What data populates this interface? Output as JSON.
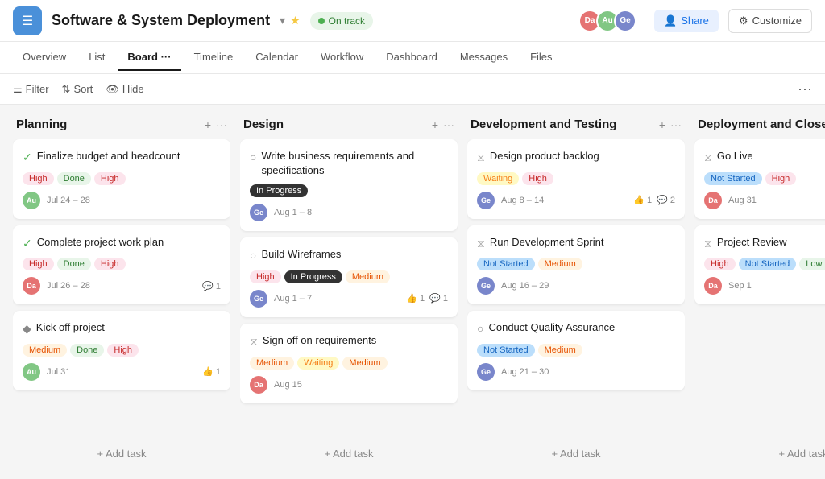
{
  "header": {
    "menu_label": "☰",
    "project_title": "Software & System Deployment",
    "chevron": "▾",
    "star": "★",
    "status": "On track",
    "share_label": "Share",
    "customize_label": "Customize",
    "avatars": [
      {
        "initials": "Da",
        "class": "av-da"
      },
      {
        "initials": "Au",
        "class": "av-au"
      },
      {
        "initials": "Ge",
        "class": "av-ge"
      }
    ]
  },
  "nav_tabs": [
    {
      "label": "Overview",
      "active": false
    },
    {
      "label": "List",
      "active": false
    },
    {
      "label": "Board",
      "active": true
    },
    {
      "label": "Timeline",
      "active": false
    },
    {
      "label": "Calendar",
      "active": false
    },
    {
      "label": "Workflow",
      "active": false
    },
    {
      "label": "Dashboard",
      "active": false
    },
    {
      "label": "Messages",
      "active": false
    },
    {
      "label": "Files",
      "active": false
    }
  ],
  "toolbar": {
    "filter_label": "Filter",
    "sort_label": "Sort",
    "hide_label": "Hide"
  },
  "board": {
    "columns": [
      {
        "id": "planning",
        "title": "Planning",
        "cards": [
          {
            "id": "c1",
            "icon_type": "check",
            "icon": "✓",
            "title": "Finalize budget and headcount",
            "tags": [
              {
                "label": "High",
                "class": "tag-high"
              },
              {
                "label": "Done",
                "class": "tag-done"
              },
              {
                "label": "High",
                "class": "tag-high"
              }
            ],
            "avatar_initials": "Au",
            "avatar_class": "av-au",
            "date": "Jul 24 – 28",
            "meta": []
          },
          {
            "id": "c2",
            "icon_type": "check",
            "icon": "✓",
            "title": "Complete project work plan",
            "tags": [
              {
                "label": "High",
                "class": "tag-high"
              },
              {
                "label": "Done",
                "class": "tag-done"
              },
              {
                "label": "High",
                "class": "tag-high"
              }
            ],
            "avatar_initials": "Da",
            "avatar_class": "av-da",
            "date": "Jul 26 – 28",
            "meta": [
              {
                "icon": "💬",
                "count": "1"
              }
            ]
          },
          {
            "id": "c3",
            "icon_type": "diamond",
            "icon": "◆",
            "title": "Kick off project",
            "tags": [
              {
                "label": "Medium",
                "class": "tag-medium"
              },
              {
                "label": "Done",
                "class": "tag-done"
              },
              {
                "label": "High",
                "class": "tag-high"
              }
            ],
            "avatar_initials": "Au",
            "avatar_class": "av-au",
            "date": "Jul 31",
            "meta": [
              {
                "icon": "👍",
                "count": "1"
              }
            ]
          }
        ],
        "add_task": "+ Add task"
      },
      {
        "id": "design",
        "title": "Design",
        "cards": [
          {
            "id": "c4",
            "icon_type": "circle",
            "icon": "○",
            "title": "Write business requirements and specifications",
            "tags": [
              {
                "label": "In Progress",
                "class": "tag-in-progress"
              }
            ],
            "avatar_initials": "Ge",
            "avatar_class": "av-ge",
            "date": "Aug 1 – 8",
            "meta": []
          },
          {
            "id": "c5",
            "icon_type": "circle",
            "icon": "○",
            "title": "Build Wireframes",
            "tags": [
              {
                "label": "High",
                "class": "tag-high"
              },
              {
                "label": "In Progress",
                "class": "tag-in-progress"
              },
              {
                "label": "Medium",
                "class": "tag-medium"
              }
            ],
            "avatar_initials": "Ge",
            "avatar_class": "av-ge",
            "date": "Aug 1 – 7",
            "meta": [
              {
                "icon": "👍",
                "count": "1"
              },
              {
                "icon": "💬",
                "count": "1"
              }
            ]
          },
          {
            "id": "c6",
            "icon_type": "hourglass",
            "icon": "⧖",
            "title": "Sign off on requirements",
            "tags": [
              {
                "label": "Medium",
                "class": "tag-medium"
              },
              {
                "label": "Waiting",
                "class": "tag-waiting"
              },
              {
                "label": "Medium",
                "class": "tag-medium"
              }
            ],
            "avatar_initials": "Da",
            "avatar_class": "av-da",
            "date": "Aug 15",
            "meta": []
          }
        ],
        "add_task": "+ Add task"
      },
      {
        "id": "dev-testing",
        "title": "Development and Testing",
        "cards": [
          {
            "id": "c7",
            "icon_type": "hourglass",
            "icon": "⧖",
            "title": "Design product backlog",
            "tags": [
              {
                "label": "Waiting",
                "class": "tag-waiting"
              },
              {
                "label": "High",
                "class": "tag-high"
              }
            ],
            "avatar_initials": "Ge",
            "avatar_class": "av-ge",
            "date": "Aug 8 – 14",
            "meta": [
              {
                "icon": "👍",
                "count": "1"
              },
              {
                "icon": "💬",
                "count": "2"
              }
            ]
          },
          {
            "id": "c8",
            "icon_type": "hourglass",
            "icon": "⧖",
            "title": "Run Development Sprint",
            "tags": [
              {
                "label": "Not Started",
                "class": "tag-not-started"
              },
              {
                "label": "Medium",
                "class": "tag-medium"
              }
            ],
            "avatar_initials": "Ge",
            "avatar_class": "av-ge",
            "date": "Aug 16 – 29",
            "meta": []
          },
          {
            "id": "c9",
            "icon_type": "circle",
            "icon": "○",
            "title": "Conduct Quality Assurance",
            "tags": [
              {
                "label": "Not Started",
                "class": "tag-not-started"
              },
              {
                "label": "Medium",
                "class": "tag-medium"
              }
            ],
            "avatar_initials": "Ge",
            "avatar_class": "av-ge",
            "date": "Aug 21 – 30",
            "meta": []
          }
        ],
        "add_task": "+ Add task"
      },
      {
        "id": "deployment",
        "title": "Deployment and Close Out",
        "cards": [
          {
            "id": "c10",
            "icon_type": "hourglass",
            "icon": "⧖",
            "title": "Go Live",
            "tags": [
              {
                "label": "Not Started",
                "class": "tag-not-started"
              },
              {
                "label": "High",
                "class": "tag-high"
              }
            ],
            "avatar_initials": "Da",
            "avatar_class": "av-da",
            "date": "Aug 31",
            "meta": []
          },
          {
            "id": "c11",
            "icon_type": "hourglass",
            "icon": "⧖",
            "title": "Project Review",
            "tags": [
              {
                "label": "High",
                "class": "tag-high"
              },
              {
                "label": "Not Started",
                "class": "tag-not-started"
              },
              {
                "label": "Low",
                "class": "tag-low"
              }
            ],
            "avatar_initials": "Da",
            "avatar_class": "av-da",
            "date": "Sep 1",
            "meta": []
          }
        ],
        "add_task": "+ Add task"
      }
    ]
  }
}
